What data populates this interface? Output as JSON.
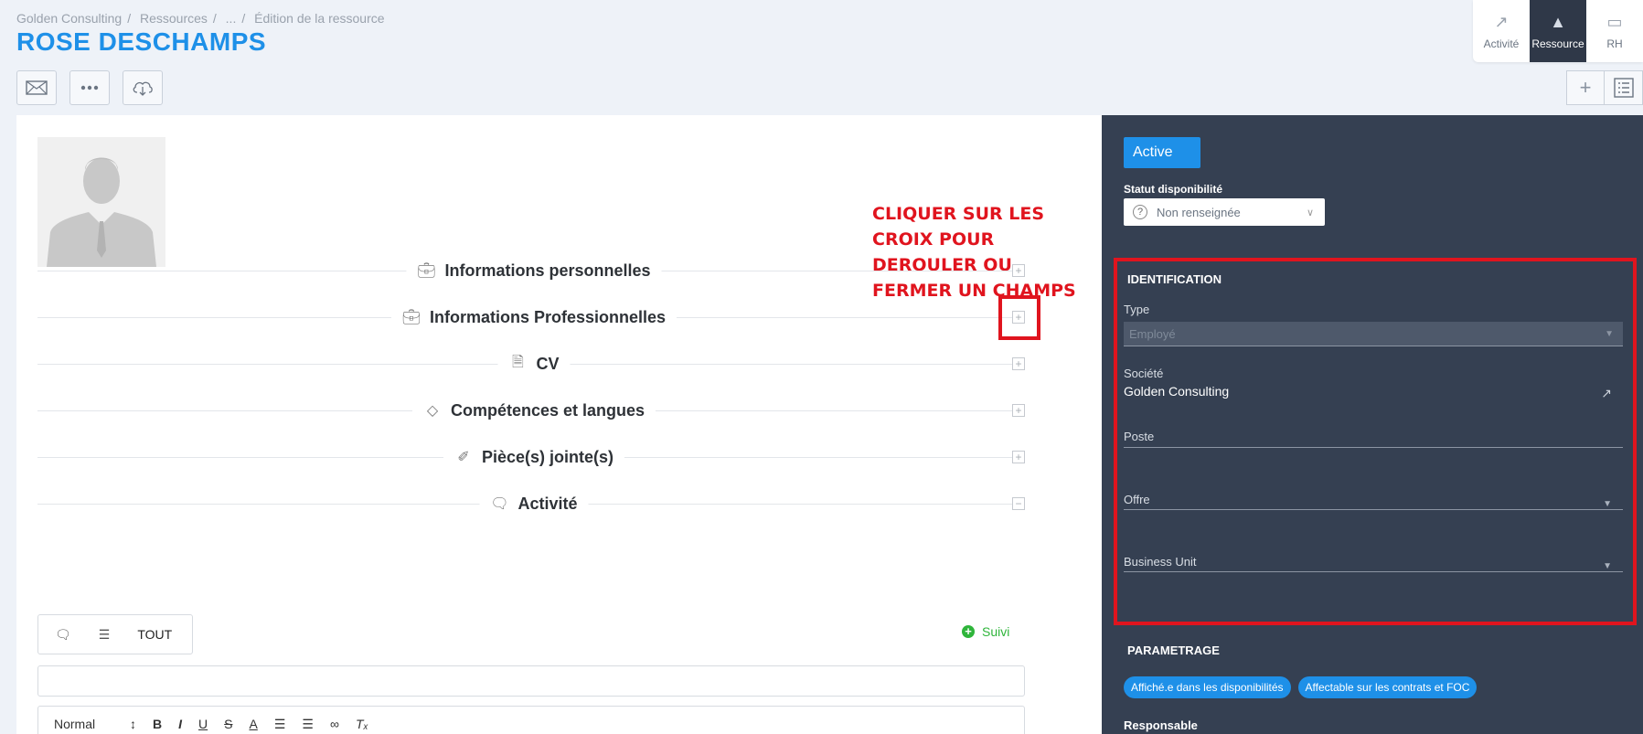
{
  "breadcrumb": [
    "Golden Consulting",
    "Ressources",
    "...",
    "Édition de la ressource"
  ],
  "page_title": "ROSE DESCHAMPS",
  "modules": [
    {
      "label": "Activité",
      "icon": "chart-icon"
    },
    {
      "label": "Ressource",
      "icon": "person-icon"
    },
    {
      "label": "RH",
      "icon": "folder-icon"
    }
  ],
  "annotation": "CLIQUER SUR LES CROIX POUR DEROULER OU FERMER UN CHAMPS",
  "sections": [
    {
      "label": "Informations personnelles",
      "icon": "briefcase-icon",
      "toggle": "+"
    },
    {
      "label": "Informations Professionnelles",
      "icon": "briefcase-icon",
      "toggle": "+"
    },
    {
      "label": "CV",
      "icon": "document-icon",
      "toggle": "+"
    },
    {
      "label": "Compétences et langues",
      "icon": "graduation-cap-icon",
      "toggle": "+"
    },
    {
      "label": "Pièce(s) jointe(s)",
      "icon": "paperclip-icon",
      "toggle": "+"
    },
    {
      "label": "Activité",
      "icon": "chat-icon",
      "toggle": "−"
    }
  ],
  "activity": {
    "tab_all": "TOUT",
    "suivi_label": "Suivi",
    "format_select": "Normal"
  },
  "sidebar": {
    "status_badge": "Active",
    "availability_label": "Statut disponibilité",
    "availability_value": "Non renseignée",
    "identification_title": "IDENTIFICATION",
    "type_label": "Type",
    "type_value": "Employé",
    "company_label": "Société",
    "company_value": "Golden Consulting",
    "position_label": "Poste",
    "offer_label": "Offre",
    "bu_label": "Business Unit",
    "settings_title": "PARAMETRAGE",
    "chips": [
      "Affiché.e dans les disponibilités",
      "Affectable sur les contrats et FOC"
    ],
    "manager_label": "Responsable"
  }
}
